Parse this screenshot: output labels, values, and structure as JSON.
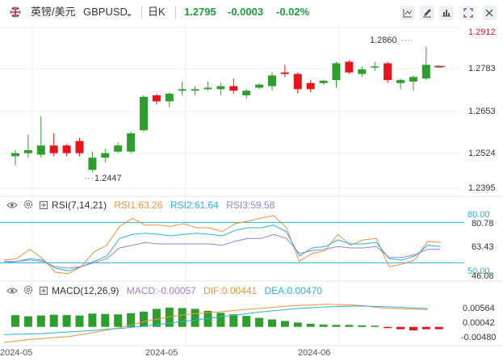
{
  "header": {
    "symbol_name": "英镑/美元",
    "symbol_code": "GBPUSD",
    "period": "日K",
    "price": "1.2795",
    "change": "-0.0003",
    "change_pct": "-0.02%",
    "toolbar_icons": [
      "chart-type-icon",
      "draw-icon",
      "indicator-icon",
      "fullscreen-icon",
      "settings-icon"
    ]
  },
  "colors": {
    "up": "#2e9e2e",
    "down": "#e8141b",
    "price_line": "#e8141b",
    "grid": "#eeeeee",
    "rsi1": "#f0923b",
    "rsi2": "#27b3d6",
    "rsi3": "#9b7fd6",
    "dif": "#f0923b",
    "dea": "#27b3d6",
    "ref_line": "#27b3d6"
  },
  "price_axis": {
    "ticks": [
      "1.2912",
      "1.2783",
      "1.2653",
      "1.2524",
      "1.2395"
    ],
    "top_tick": "1.2912"
  },
  "annotations": {
    "high_label": "1.2860",
    "low_label": "1.2447"
  },
  "rsi": {
    "title": "RSI(7,14,21)",
    "rsi1_label": "RSI1:63.26",
    "rsi2_label": "RSI2:61.64",
    "rsi3_label": "RSI3:59.58",
    "axis": [
      "80.00",
      "80.78",
      "63.43",
      "50.00",
      "46.08"
    ]
  },
  "macd": {
    "title": "MACD(12,26,9)",
    "macd_label": "MACD:-0.00057",
    "dif_label": "DIF:0.00441",
    "dea_label": "DEA:0.00470",
    "axis": [
      "0.00564",
      "0.00042",
      "-0.00480"
    ]
  },
  "x_axis": {
    "labels": [
      "2024-05",
      "2024-05",
      "2024-06"
    ]
  },
  "chart_data": {
    "type": "candlestick",
    "ylim": [
      1.2395,
      1.2912
    ],
    "candles": [
      {
        "o": 1.25,
        "h": 1.252,
        "l": 1.247,
        "c": 1.251
      },
      {
        "o": 1.251,
        "h": 1.257,
        "l": 1.2495,
        "c": 1.252
      },
      {
        "o": 1.2505,
        "h": 1.263,
        "l": 1.2495,
        "c": 1.2535
      },
      {
        "o": 1.2535,
        "h": 1.2575,
        "l": 1.25,
        "c": 1.251
      },
      {
        "o": 1.2535,
        "h": 1.254,
        "l": 1.25,
        "c": 1.251
      },
      {
        "o": 1.255,
        "h": 1.256,
        "l": 1.25,
        "c": 1.251
      },
      {
        "o": 1.2455,
        "h": 1.2515,
        "l": 1.2447,
        "c": 1.2495
      },
      {
        "o": 1.2495,
        "h": 1.2525,
        "l": 1.248,
        "c": 1.251
      },
      {
        "o": 1.2515,
        "h": 1.2545,
        "l": 1.251,
        "c": 1.2535
      },
      {
        "o": 1.2515,
        "h": 1.258,
        "l": 1.251,
        "c": 1.2575
      },
      {
        "o": 1.2585,
        "h": 1.27,
        "l": 1.258,
        "c": 1.2695
      },
      {
        "o": 1.27,
        "h": 1.2705,
        "l": 1.267,
        "c": 1.268
      },
      {
        "o": 1.268,
        "h": 1.271,
        "l": 1.266,
        "c": 1.2705
      },
      {
        "o": 1.2715,
        "h": 1.2745,
        "l": 1.27,
        "c": 1.272
      },
      {
        "o": 1.2715,
        "h": 1.273,
        "l": 1.27,
        "c": 1.272
      },
      {
        "o": 1.272,
        "h": 1.2745,
        "l": 1.2715,
        "c": 1.2725
      },
      {
        "o": 1.272,
        "h": 1.274,
        "l": 1.27,
        "c": 1.273
      },
      {
        "o": 1.273,
        "h": 1.2755,
        "l": 1.2705,
        "c": 1.2715
      },
      {
        "o": 1.27,
        "h": 1.272,
        "l": 1.269,
        "c": 1.2715
      },
      {
        "o": 1.2725,
        "h": 1.274,
        "l": 1.272,
        "c": 1.2735
      },
      {
        "o": 1.273,
        "h": 1.2775,
        "l": 1.2715,
        "c": 1.2765
      },
      {
        "o": 1.2775,
        "h": 1.28,
        "l": 1.276,
        "c": 1.277
      },
      {
        "o": 1.277,
        "h": 1.2775,
        "l": 1.2705,
        "c": 1.272
      },
      {
        "o": 1.274,
        "h": 1.275,
        "l": 1.271,
        "c": 1.272
      },
      {
        "o": 1.274,
        "h": 1.275,
        "l": 1.2735,
        "c": 1.2748
      },
      {
        "o": 1.275,
        "h": 1.281,
        "l": 1.2725,
        "c": 1.2805
      },
      {
        "o": 1.281,
        "h": 1.2815,
        "l": 1.277,
        "c": 1.2775
      },
      {
        "o": 1.277,
        "h": 1.2795,
        "l": 1.276,
        "c": 1.2785
      },
      {
        "o": 1.2795,
        "h": 1.281,
        "l": 1.278,
        "c": 1.2795
      },
      {
        "o": 1.2805,
        "h": 1.281,
        "l": 1.274,
        "c": 1.275
      },
      {
        "o": 1.274,
        "h": 1.2755,
        "l": 1.272,
        "c": 1.275
      },
      {
        "o": 1.2745,
        "h": 1.2765,
        "l": 1.2715,
        "c": 1.276
      },
      {
        "o": 1.2755,
        "h": 1.286,
        "l": 1.275,
        "c": 1.28
      },
      {
        "o": 1.2795,
        "h": 1.28,
        "l": 1.2795,
        "c": 1.2795
      }
    ],
    "rsi": {
      "ylim": [
        40,
        88
      ],
      "rsi1": [
        52,
        53,
        60,
        53,
        43,
        42,
        47,
        58,
        63,
        77,
        83,
        78,
        78,
        77,
        79,
        76,
        76,
        73,
        79,
        81,
        83,
        85,
        76,
        51,
        57,
        59,
        71,
        63,
        67,
        68,
        47,
        49,
        52,
        66,
        65
      ],
      "rsi2": [
        50,
        51,
        53,
        52,
        46,
        44,
        47,
        51,
        55,
        68,
        71,
        72,
        71,
        70,
        71,
        72,
        71,
        70,
        74,
        76,
        76,
        78,
        73,
        55,
        61,
        62,
        67,
        64,
        64,
        65,
        53,
        52,
        55,
        63,
        62
      ],
      "rsi3": [
        51,
        51,
        52,
        51,
        47,
        46,
        47,
        50,
        53,
        61,
        63,
        65,
        64,
        64,
        64,
        64,
        64,
        63,
        66,
        68,
        68,
        71,
        68,
        57,
        59,
        60,
        62,
        61,
        61,
        62,
        54,
        54,
        56,
        60,
        60
      ]
    },
    "macd": {
      "ylim": [
        -0.0048,
        0.0084
      ],
      "hist": [
        0.003,
        0.0027,
        0.0029,
        0.0031,
        0.003,
        0.0029,
        0.0034,
        0.0033,
        0.0032,
        0.0035,
        0.0039,
        0.0046,
        0.0049,
        0.0048,
        0.0046,
        0.0041,
        0.0036,
        0.0032,
        0.0028,
        0.0023,
        0.0019,
        0.0015,
        0.0011,
        0.0008,
        0.0006,
        0.0005,
        0.0005,
        0.0004,
        0.0003,
        -0.0003,
        -0.0006,
        -0.0009,
        -0.0006,
        -0.0006
      ],
      "dif": [
        -0.004,
        -0.0036,
        -0.0032,
        -0.003,
        -0.0027,
        -0.0025,
        -0.002,
        -0.0014,
        -0.0008,
        -0.0002,
        0.0006,
        0.0014,
        0.002,
        0.0026,
        0.0031,
        0.0034,
        0.0036,
        0.0039,
        0.0042,
        0.0045,
        0.0047,
        0.005,
        0.0053,
        0.0055,
        0.0056,
        0.0058,
        0.0057,
        0.0056,
        0.0054,
        0.005,
        0.0047,
        0.0046,
        0.0045,
        0.0044
      ],
      "dea": [
        -0.002,
        -0.0019,
        -0.0018,
        -0.0017,
        -0.0015,
        -0.0013,
        -0.0011,
        -0.0009,
        -0.0006,
        -0.0004,
        -0.0001,
        0.0002,
        0.0006,
        0.001,
        0.0014,
        0.0018,
        0.0022,
        0.0026,
        0.003,
        0.0034,
        0.0038,
        0.0041,
        0.0044,
        0.0047,
        0.0049,
        0.0051,
        0.0052,
        0.0053,
        0.0053,
        0.0052,
        0.0051,
        0.005,
        0.0048,
        0.0047
      ]
    }
  }
}
